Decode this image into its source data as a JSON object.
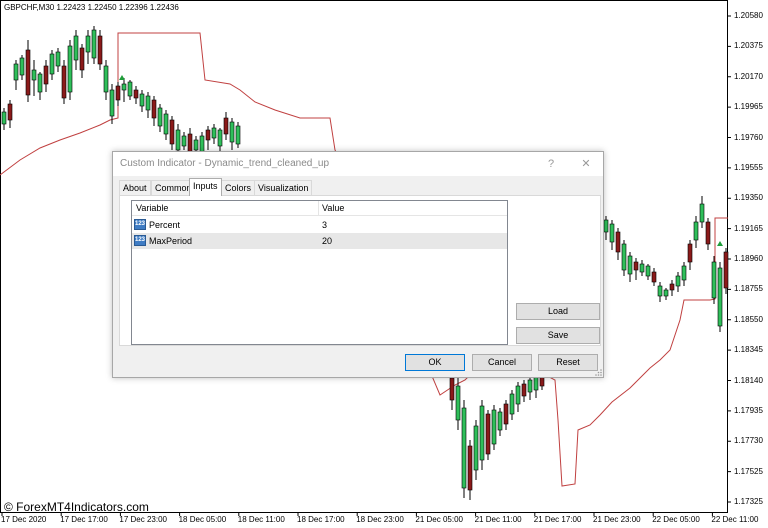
{
  "chart": {
    "symbol_info": "GBPCHF,M30  1.22423 1.22450 1.22396 1.22436",
    "watermark": "© ForexMT4Indicators.com",
    "price_axis": [
      "1.20580",
      "1.20375",
      "1.20170",
      "1.19965",
      "1.19760",
      "1.19555",
      "1.19350",
      "1.19165",
      "1.18960",
      "1.18755",
      "1.18550",
      "1.18345",
      "1.18140",
      "1.17935",
      "1.17730",
      "1.17525",
      "1.17325"
    ],
    "time_axis": [
      "17 Dec 2020",
      "17 Dec 17:00",
      "17 Dec 23:00",
      "18 Dec 05:00",
      "18 Dec 11:00",
      "18 Dec 17:00",
      "18 Dec 23:00",
      "21 Dec 05:00",
      "21 Dec 11:00",
      "21 Dec 17:00",
      "21 Dec 23:00",
      "22 Dec 05:00",
      "22 Dec 11:00"
    ],
    "colors": {
      "bull": "#2fbf5a",
      "bear": "#8b1a1a",
      "line": "#c04040",
      "grid_border": "#000000",
      "arrow": "#1f9d3a"
    }
  },
  "dialog": {
    "title": "Custom Indicator - Dynamic_trend_cleaned_up",
    "help_icon": "?",
    "close_icon": "✕",
    "tabs": [
      {
        "label": "About",
        "active": false
      },
      {
        "label": "Common",
        "active": false
      },
      {
        "label": "Inputs",
        "active": true
      },
      {
        "label": "Colors",
        "active": false
      },
      {
        "label": "Visualization",
        "active": false
      }
    ],
    "table": {
      "col_variable": "Variable",
      "col_value": "Value",
      "icon_text": "123",
      "rows": [
        {
          "name": "Percent",
          "value": "3"
        },
        {
          "name": "MaxPeriod",
          "value": "20"
        }
      ]
    },
    "buttons": {
      "load": "Load",
      "save": "Save",
      "ok": "OK",
      "cancel": "Cancel",
      "reset": "Reset"
    }
  }
}
